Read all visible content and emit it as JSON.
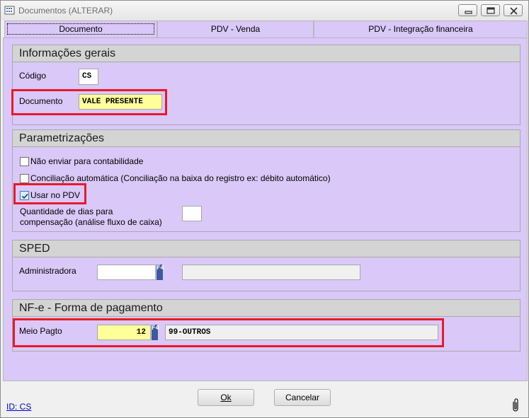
{
  "window": {
    "title": "Documentos (ALTERAR)",
    "controls": {
      "minimize": "minimize-icon",
      "maximize": "maximize-icon",
      "close": "close-icon"
    }
  },
  "tabs": [
    {
      "label": "Documento",
      "active": true
    },
    {
      "label": "PDV - Venda",
      "active": false
    },
    {
      "label": "PDV - Integração financeira",
      "active": false
    }
  ],
  "general": {
    "header": "Informações gerais",
    "codigo_label": "Código",
    "codigo_value": "CS",
    "documento_label": "Documento",
    "documento_value": "VALE PRESENTE"
  },
  "params": {
    "header": "Parametrizações",
    "checkboxes": [
      {
        "label": "Não enviar para contabilidade",
        "checked": false
      },
      {
        "label": "Conciliação automática (Conciliação na baixa do registro ex: débito automático)",
        "checked": false
      },
      {
        "label": "Usar no PDV",
        "checked": true
      }
    ],
    "dias_label_line1": "Quantidade de dias para",
    "dias_label_line2": "compensação (análise fluxo de caixa)",
    "dias_value": ""
  },
  "sped": {
    "header": "SPED",
    "administradora_label": "Administradora",
    "administradora_code": "",
    "administradora_desc": "",
    "lookup_key": "F4"
  },
  "nfe": {
    "header": "NF-e - Forma de pagamento",
    "meio_label": "Meio Pagto",
    "meio_code": "12",
    "meio_desc": "99-OUTROS",
    "lookup_key": "F4"
  },
  "footer": {
    "ok_label": "Ok",
    "cancel_label": "Cancelar",
    "id_link": "ID: CS",
    "attachment_icon": "paperclip-icon"
  },
  "colors": {
    "panel": "#dac8f8",
    "highlight": "#e8192c",
    "field_yellow": "#ffff99",
    "lookup_key": "#3d5a9f"
  }
}
